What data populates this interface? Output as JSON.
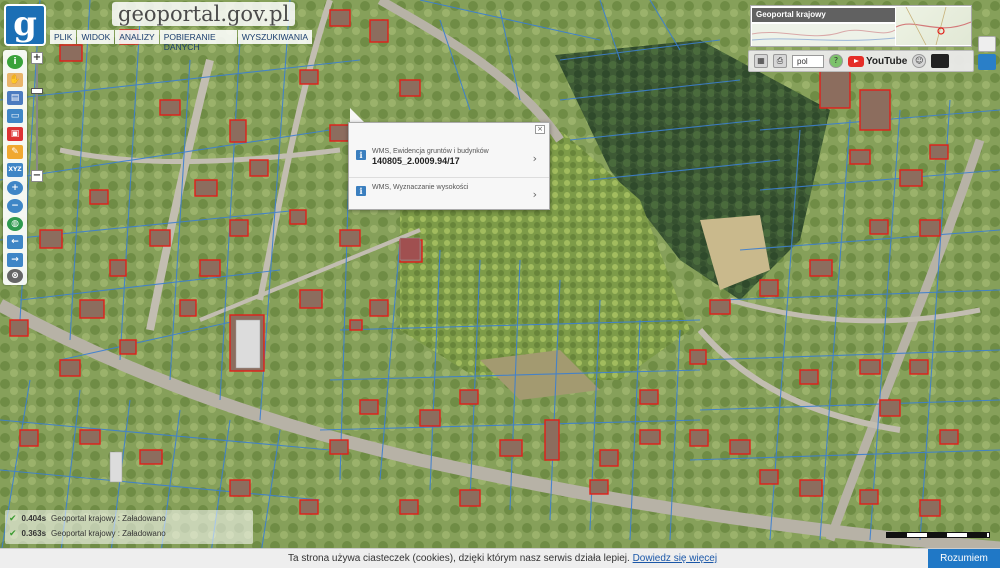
{
  "header": {
    "logo_letter": "g",
    "site_title": "geoportal.gov.pl"
  },
  "menu": {
    "items": [
      "PLIK",
      "WIDOK",
      "ANALIZY",
      "POBIERANIE DANYCH",
      "WYSZUKIWANIA"
    ]
  },
  "zoom": {
    "plus": "+",
    "minus": "−"
  },
  "mini_map": {
    "label": "Geoportal krajowy"
  },
  "controls": {
    "language": "pol",
    "youtube": "YouTube"
  },
  "popup": {
    "close": "×",
    "rows": [
      {
        "small": "WMS, Ewidencja gruntów i budynków",
        "big": "140805_2.0009.94/17"
      },
      {
        "small": "WMS, Wyznaczanie wysokości",
        "big": ""
      }
    ]
  },
  "status": {
    "rows": [
      {
        "time": "0.404s",
        "text": "Geoportal krajowy : Załadowano"
      },
      {
        "time": "0.363s",
        "text": "Geoportal krajowy : Załadowano"
      }
    ]
  },
  "cookie": {
    "text": "Ta strona używa ciasteczek (cookies), dzięki którym nasz serwis działa lepiej. ",
    "link": "Dowiedz się więcej",
    "button": "Rozumiem"
  },
  "colors": {
    "brand_blue": "#1b6fb5",
    "parcel_line": "#3c7fd0",
    "building_outline": "#e0201a",
    "accept_button": "#2078c6"
  }
}
